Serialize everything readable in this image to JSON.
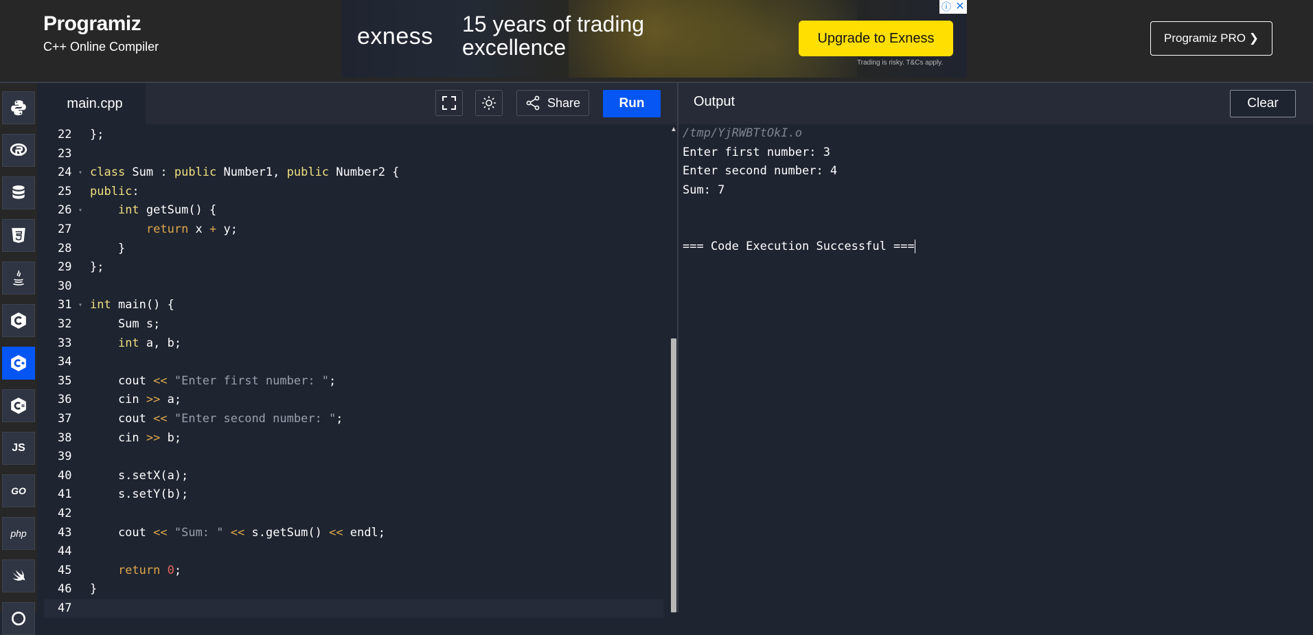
{
  "header": {
    "logo": "Programiz",
    "subtitle": "C++ Online Compiler",
    "pro_button": "Programiz PRO ❯"
  },
  "ad": {
    "brand": "exness",
    "headline": "15 years of trading excellence",
    "cta": "Upgrade to Exness",
    "fine_print": "Trading is risky. T&Cs apply.",
    "info_icon": "ⓘ",
    "close_icon": "✕"
  },
  "sidebar": {
    "languages": [
      {
        "name": "python-icon"
      },
      {
        "name": "r-icon"
      },
      {
        "name": "sql-icon"
      },
      {
        "name": "html-icon"
      },
      {
        "name": "java-icon"
      },
      {
        "name": "c-icon"
      },
      {
        "name": "cpp-icon",
        "active": true
      },
      {
        "name": "csharp-icon"
      },
      {
        "name": "js-icon",
        "label": "JS"
      },
      {
        "name": "go-icon",
        "label": "GO"
      },
      {
        "name": "php-icon",
        "label": "php"
      },
      {
        "name": "swift-icon"
      },
      {
        "name": "rust-icon"
      }
    ]
  },
  "editor": {
    "tab": "main.cpp",
    "share_label": "Share",
    "run_label": "Run",
    "lines": [
      {
        "n": "22",
        "code": "};"
      },
      {
        "n": "23",
        "code": ""
      },
      {
        "n": "24",
        "code": "class Sum : public Number1, public Number2 {",
        "fold": true
      },
      {
        "n": "25",
        "code": "public:"
      },
      {
        "n": "26",
        "code": "    int getSum() {",
        "fold": true
      },
      {
        "n": "27",
        "code": "        return x + y;"
      },
      {
        "n": "28",
        "code": "    }"
      },
      {
        "n": "29",
        "code": "};"
      },
      {
        "n": "30",
        "code": ""
      },
      {
        "n": "31",
        "code": "int main() {",
        "fold": true
      },
      {
        "n": "32",
        "code": "    Sum s;"
      },
      {
        "n": "33",
        "code": "    int a, b;"
      },
      {
        "n": "34",
        "code": ""
      },
      {
        "n": "35",
        "code": "    cout << \"Enter first number: \";"
      },
      {
        "n": "36",
        "code": "    cin >> a;"
      },
      {
        "n": "37",
        "code": "    cout << \"Enter second number: \";"
      },
      {
        "n": "38",
        "code": "    cin >> b;"
      },
      {
        "n": "39",
        "code": ""
      },
      {
        "n": "40",
        "code": "    s.setX(a);"
      },
      {
        "n": "41",
        "code": "    s.setY(b);"
      },
      {
        "n": "42",
        "code": ""
      },
      {
        "n": "43",
        "code": "    cout << \"Sum: \" << s.getSum() << endl;"
      },
      {
        "n": "44",
        "code": ""
      },
      {
        "n": "45",
        "code": "    return 0;"
      },
      {
        "n": "46",
        "code": "}"
      },
      {
        "n": "47",
        "code": "",
        "current": true
      }
    ]
  },
  "output": {
    "title": "Output",
    "clear_label": "Clear",
    "path": "/tmp/YjRWBTtOkI.o",
    "lines": [
      "Enter first number: 3",
      "Enter second number: 4",
      "Sum: 7",
      "",
      "",
      "=== Code Execution Successful ==="
    ]
  }
}
